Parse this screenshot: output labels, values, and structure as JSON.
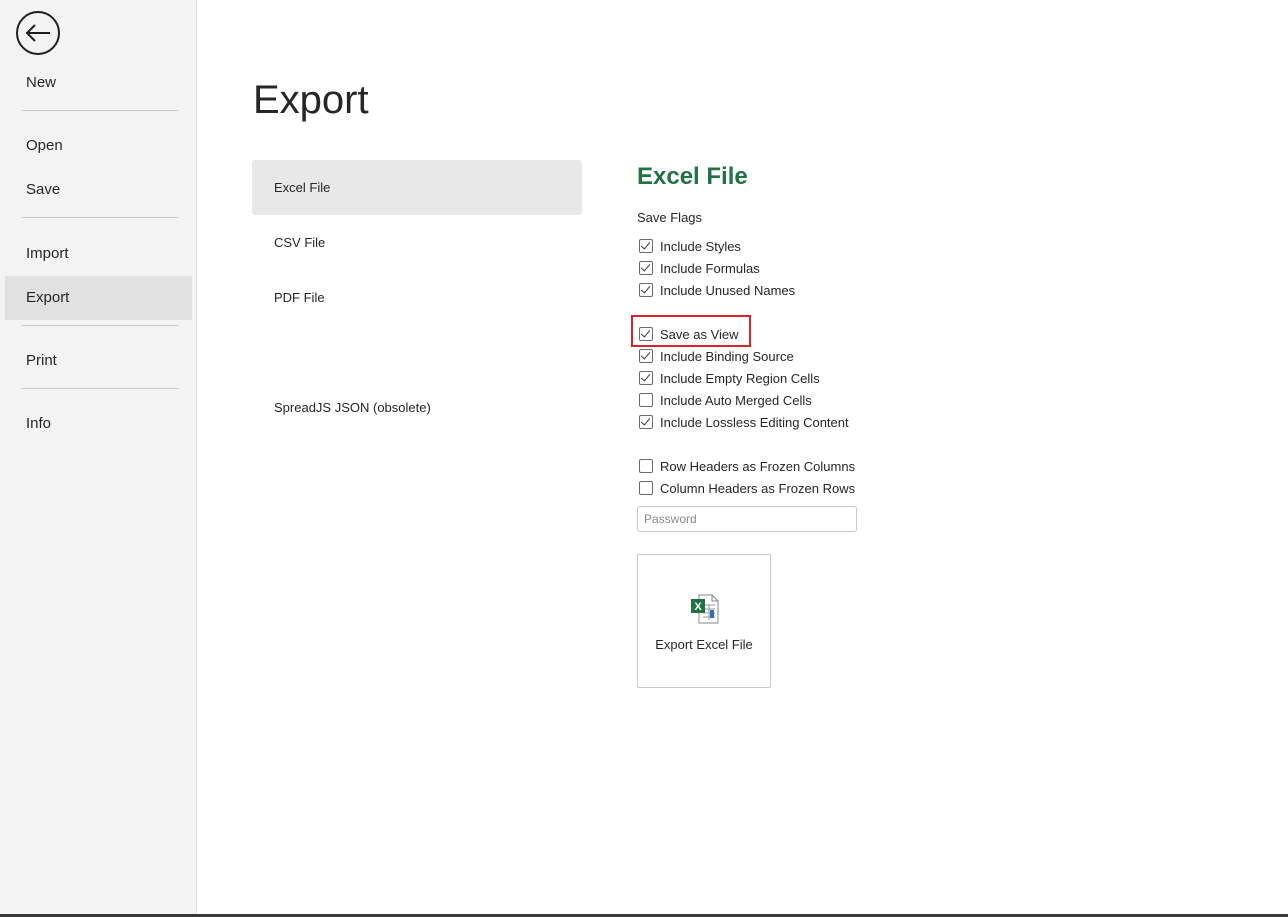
{
  "sidebar": {
    "back_icon": "arrow-left-icon",
    "items": [
      {
        "label": "New"
      },
      {
        "label": "Open"
      },
      {
        "label": "Save"
      },
      {
        "label": "Import"
      },
      {
        "label": "Export",
        "active": true
      },
      {
        "label": "Print"
      },
      {
        "label": "Info"
      }
    ]
  },
  "main": {
    "title": "Export",
    "formats": [
      {
        "label": "Excel File",
        "active": true
      },
      {
        "label": "CSV File"
      },
      {
        "label": "PDF File"
      },
      {
        "label": "SpreadJS JSON (obsolete)"
      }
    ],
    "panel": {
      "title": "Excel File",
      "flags_label": "Save Flags",
      "checkboxes": [
        {
          "label": "Include Styles",
          "checked": true
        },
        {
          "label": "Include Formulas",
          "checked": true
        },
        {
          "label": "Include Unused Names",
          "checked": true
        },
        {
          "label": "Save as View",
          "checked": true
        },
        {
          "label": "Include Binding Source",
          "checked": true
        },
        {
          "label": "Include Empty Region Cells",
          "checked": true
        },
        {
          "label": "Include Auto Merged Cells",
          "checked": false
        },
        {
          "label": "Include Lossless Editing Content",
          "checked": true
        },
        {
          "label": "Row Headers as Frozen Columns",
          "checked": false
        },
        {
          "label": "Column Headers as Frozen Rows",
          "checked": false
        }
      ],
      "password_placeholder": "Password",
      "password_value": "",
      "export_button_label": "Export Excel File",
      "export_button_icon": "excel-file-icon"
    }
  },
  "colors": {
    "accent_green": "#217346",
    "highlight_red": "#e0202c",
    "sidebar_bg": "#f3f3f3",
    "active_bg": "#e1e1e1"
  }
}
